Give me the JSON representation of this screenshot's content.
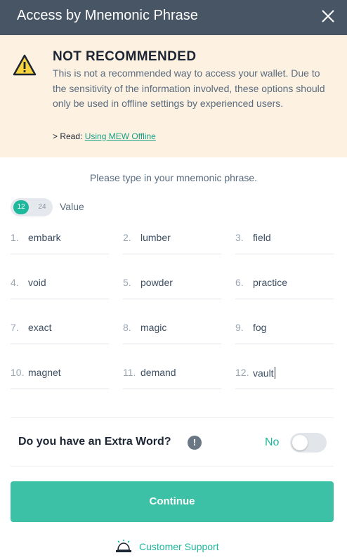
{
  "header": {
    "title": "Access by Mnemonic Phrase"
  },
  "warning": {
    "title": "NOT RECOMMENDED",
    "body": "This is not a recommended way to access your wallet. Due to the sensitivity of the information involved, these options should only be used in offline settings by experienced users.",
    "read_prefix": "> Read: ",
    "read_link": "Using MEW Offline"
  },
  "prompt": "Please type in your mnemonic phrase.",
  "word_count": {
    "option_12": "12",
    "option_24": "24",
    "selected": "12",
    "label": "Value"
  },
  "words": [
    {
      "num": "1.",
      "value": "embark"
    },
    {
      "num": "2.",
      "value": "lumber"
    },
    {
      "num": "3.",
      "value": "field"
    },
    {
      "num": "4.",
      "value": "void"
    },
    {
      "num": "5.",
      "value": "powder"
    },
    {
      "num": "6.",
      "value": "practice"
    },
    {
      "num": "7.",
      "value": "exact"
    },
    {
      "num": "8.",
      "value": "magic"
    },
    {
      "num": "9.",
      "value": "fog"
    },
    {
      "num": "10.",
      "value": "magnet"
    },
    {
      "num": "11.",
      "value": "demand"
    },
    {
      "num": "12.",
      "value": "vault"
    }
  ],
  "extra_word": {
    "label": "Do you have an Extra Word?",
    "info": "!",
    "state": "No",
    "enabled": false
  },
  "continue_label": "Continue",
  "support_label": "Customer Support",
  "colors": {
    "header": "#485564",
    "accent": "#1eb89c",
    "button": "#3cc1a6",
    "warning_bg": "#fdf2e2",
    "warning_icon": "#f6d33f"
  }
}
